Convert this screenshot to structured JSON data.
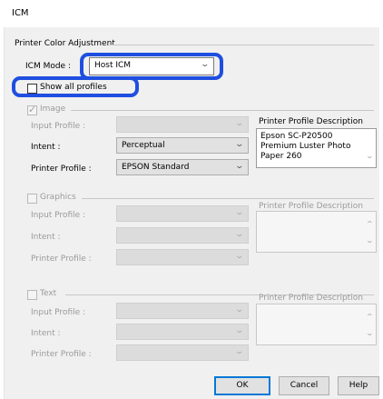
{
  "window": {
    "title": "ICM"
  },
  "group_title": "Printer Color Adjustment",
  "icm_mode": {
    "label": "ICM Mode :",
    "value": "Host ICM"
  },
  "show_all_profiles": {
    "label": "Show all profiles",
    "checked": false
  },
  "image": {
    "checkbox_label": "Image",
    "checked": true,
    "input_profile_label": "Input Profile :",
    "input_profile_value": "",
    "intent_label": "Intent :",
    "intent_value": "Perceptual",
    "printer_profile_label": "Printer Profile :",
    "printer_profile_value": "EPSON Standard",
    "description_label": "Printer Profile Description",
    "description_text": "Epson SC-P20500 Premium Luster Photo Paper 260"
  },
  "graphics": {
    "checkbox_label": "Graphics",
    "checked": false,
    "input_profile_label": "Input Profile :",
    "intent_label": "Intent :",
    "printer_profile_label": "Printer Profile :",
    "description_label": "Printer Profile Description"
  },
  "text": {
    "checkbox_label": "Text",
    "checked": false,
    "input_profile_label": "Input Profile :",
    "intent_label": "Intent :",
    "printer_profile_label": "Printer Profile :",
    "description_label": "Printer Profile Description"
  },
  "buttons": {
    "ok": "OK",
    "cancel": "Cancel",
    "help": "Help"
  },
  "colors": {
    "highlight": "#1f4fe0",
    "default_button_border": "#0078d7"
  }
}
